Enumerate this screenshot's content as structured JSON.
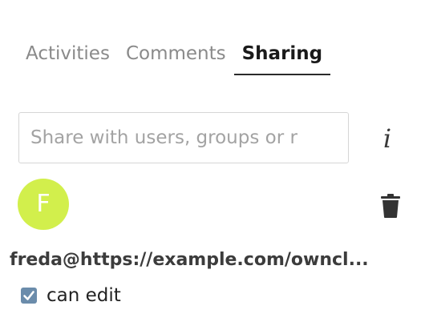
{
  "tabs": [
    {
      "label": "Activities",
      "active": false
    },
    {
      "label": "Comments",
      "active": false
    },
    {
      "label": "Sharing",
      "active": true
    }
  ],
  "share_search": {
    "placeholder": "Share with users, groups or r",
    "value": ""
  },
  "share_entry": {
    "avatar_initial": "F",
    "avatar_color": "#d2ef4c",
    "name": "freda@https://example.com/owncl...",
    "permission": {
      "label": "can edit",
      "checked": true
    }
  },
  "icons": {
    "info": "info-icon",
    "delete": "trash-icon",
    "checkbox": "checkmark-icon"
  },
  "colors": {
    "active_tab_underline": "#2b2b2b",
    "inactive_tab_text": "#8a8a8a",
    "checkbox_fill": "#6b8cab"
  }
}
